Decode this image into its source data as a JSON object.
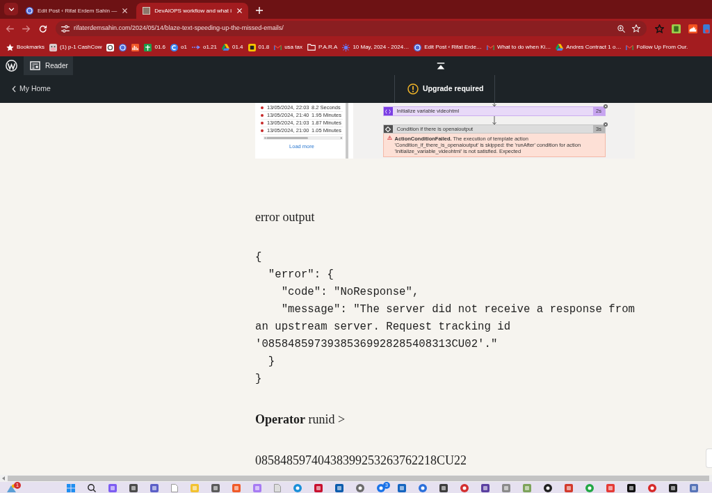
{
  "browser": {
    "tabs": [
      {
        "title": "Edit Post ‹ Rifat Erdem Sahin —",
        "kind": "logo",
        "selected": false
      },
      {
        "title": "DevAIOPS workflow and what i",
        "kind": "photo",
        "selected": true
      }
    ],
    "url": "rifaterdemsahin.com/2024/05/14/blaze-text-speeding-up-the-missed-emails/",
    "bookmarks": [
      {
        "kind": "star",
        "label": "Bookmarks"
      },
      {
        "kind": "animal",
        "label": "(1) p-1 CashCow"
      },
      {
        "kind": "ring"
      },
      {
        "kind": "logo"
      },
      {
        "kind": "chart"
      },
      {
        "kind": "sheet",
        "label": "01.6"
      },
      {
        "kind": "circle",
        "label": "o1"
      },
      {
        "kind": "arrow",
        "label": "o1.21"
      },
      {
        "kind": "triangle",
        "label": "01.4"
      },
      {
        "kind": "tile",
        "label": "01.8"
      },
      {
        "kind": "mail",
        "label": "usa tax"
      },
      {
        "kind": "folder",
        "label": "P.A.R.A"
      },
      {
        "kind": "sun",
        "label": "10 May, 2024 - 2024…"
      },
      {
        "kind": "logo",
        "label": "Edit Post ‹ Rifat Erde…"
      },
      {
        "kind": "mail",
        "label": "What to do when Ki…"
      },
      {
        "kind": "triangle",
        "label": "Andres Contract 1 o…"
      },
      {
        "kind": "mail",
        "label": "Follow Up From Our."
      }
    ]
  },
  "admin_bar": {
    "reader_button": "Reader",
    "home_link": "My Home",
    "upgrade_link": "Upgrade required"
  },
  "article": {
    "screenshot": {
      "runs": [
        {
          "time": "13/05/2024, 22:03",
          "duration": "8.2 Seconds"
        },
        {
          "time": "13/05/2024, 21:40",
          "duration": "1.95 Minutes"
        },
        {
          "time": "13/05/2024, 21:03",
          "duration": "1.87 Minutes"
        },
        {
          "time": "13/05/2024, 21:00",
          "duration": "1.05 Minutes"
        }
      ],
      "load_more": "Load more",
      "actions": [
        {
          "kind": "variable",
          "title": "Initialize variable videohtml",
          "duration": "2s"
        },
        {
          "kind": "condition",
          "title": "Condition if there is openaioutput",
          "duration": "3s",
          "error": "**ActionConditionFailed.** The execution of template action 'Condition_if_there_is_openaioutput' is skipped: the 'runAfter' condition for action 'Initialize_variable_videohtml' is not satisfied. Expected"
        }
      ]
    },
    "blocks": [
      {
        "kind": "paragraph",
        "text": "error output"
      },
      {
        "kind": "code",
        "text": "{\n  \"error\": {\n    \"code\": \"NoResponse\",\n    \"message\": \"The server did not receive a response from an upstream server. Request tracking id '08584859739385369928285408313CU02'.\"\n  }\n}"
      },
      {
        "kind": "paragraph",
        "text": "**Operator** runid >"
      },
      {
        "kind": "paragraph",
        "text": "08584859740438399253263762218CU22"
      }
    ]
  },
  "taskbar": {
    "widget_badge": "1",
    "app_badge": "3"
  }
}
